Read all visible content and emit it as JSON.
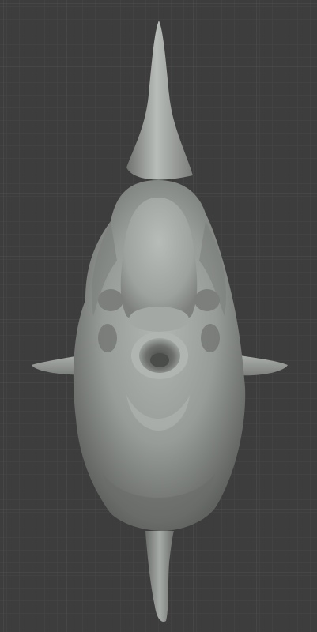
{
  "viewport": {
    "background": "#3d3d3d",
    "grid_minor_color": "#474747",
    "grid_major_color": "#525252",
    "model_color": "#9fa39f"
  },
  "model": {
    "name": "",
    "shading": "solid-matcap-grey"
  }
}
